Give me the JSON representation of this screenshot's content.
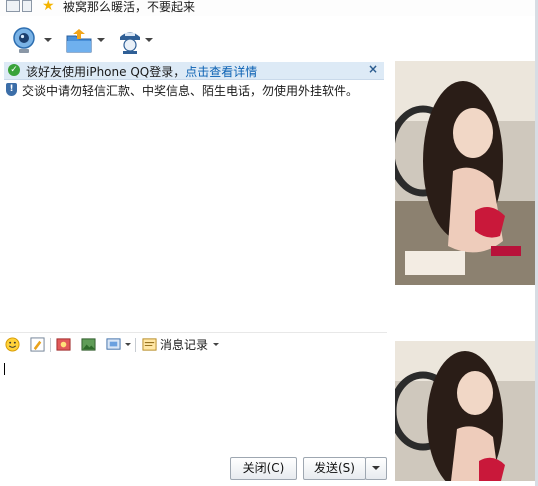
{
  "status": {
    "signature": "被窝那么暖活，不要起来"
  },
  "toolbar": {
    "items": [
      {
        "name": "video-chat"
      },
      {
        "name": "send-file"
      },
      {
        "name": "remote-assist"
      }
    ]
  },
  "notice": {
    "text": "该好友使用iPhone QQ登录，",
    "link": "点击查看详情",
    "close": "×"
  },
  "warning": {
    "text": "交谈中请勿轻信汇款、中奖信息、陌生电话，勿使用外挂软件。"
  },
  "input_toolbar": {
    "history_label": "消息记录"
  },
  "buttons": {
    "close": "关闭(C)",
    "send": "发送(S)"
  }
}
